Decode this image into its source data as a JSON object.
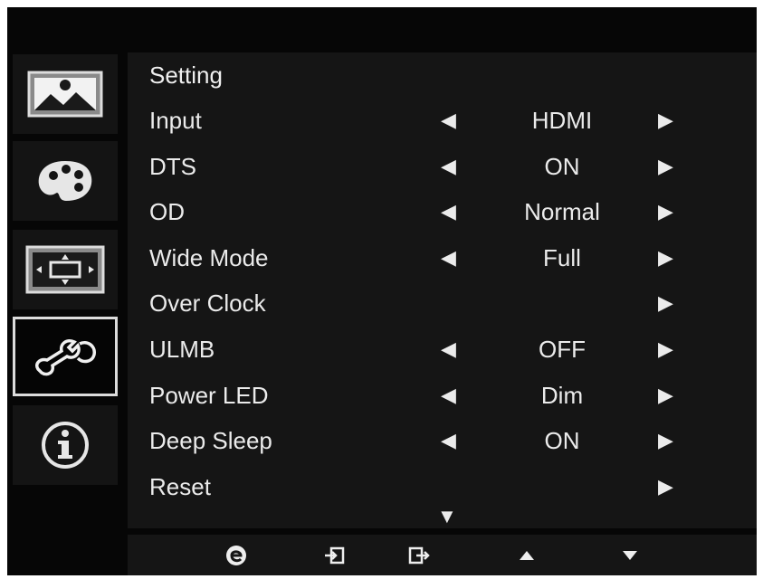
{
  "menu": {
    "title": "Setting",
    "items": [
      {
        "label": "Input",
        "value": "HDMI",
        "left": true,
        "right": true
      },
      {
        "label": "DTS",
        "value": "ON",
        "left": true,
        "right": true
      },
      {
        "label": "OD",
        "value": "Normal",
        "left": true,
        "right": true
      },
      {
        "label": "Wide Mode",
        "value": "Full",
        "left": true,
        "right": true
      },
      {
        "label": "Over Clock",
        "value": "",
        "left": false,
        "right": true
      },
      {
        "label": "ULMB",
        "value": "OFF",
        "left": true,
        "right": true
      },
      {
        "label": "Power LED",
        "value": "Dim",
        "left": true,
        "right": true
      },
      {
        "label": "Deep Sleep",
        "value": "ON",
        "left": true,
        "right": true
      },
      {
        "label": "Reset",
        "value": "",
        "left": false,
        "right": true
      }
    ]
  },
  "sidebar": {
    "tabs": [
      {
        "name": "picture-tab",
        "icon": "picture-icon"
      },
      {
        "name": "color-tab",
        "icon": "palette-icon"
      },
      {
        "name": "display-tab",
        "icon": "wide-mode-icon"
      },
      {
        "name": "setting-tab",
        "icon": "wrench-icon",
        "active": true
      },
      {
        "name": "info-tab",
        "icon": "info-icon"
      }
    ]
  },
  "glyphs": {
    "left_arrow": "◀",
    "right_arrow": "▶",
    "more": "▼"
  },
  "colors": {
    "background": "#060606",
    "panel": "#151515",
    "text": "#ebebeb",
    "active_border": "#dcdcdc"
  }
}
